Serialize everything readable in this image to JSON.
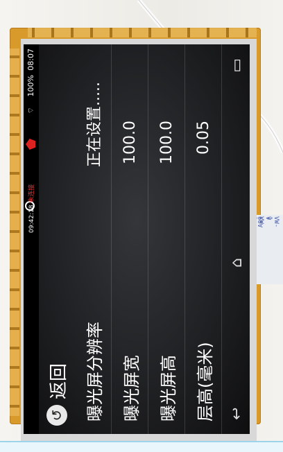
{
  "status_bar": {
    "wifi": "wifi-icon",
    "battery": "100%",
    "time": "08:07",
    "clock_small": "09:42:18",
    "status_text": "未连接"
  },
  "header": {
    "back_label": "返回"
  },
  "settings": [
    {
      "label": "曝光屏分辨率",
      "value": "正在设置....."
    },
    {
      "label": "曝光屏宽",
      "value": "100.0"
    },
    {
      "label": "曝光屏高",
      "value": "100.0"
    },
    {
      "label": "层高(毫米)",
      "value": "0.05"
    }
  ],
  "nav": {
    "back": "↩",
    "home": "⌂",
    "recent": "▭"
  },
  "ribbon_text": [
    "VW-1",
    "V  VW-1",
    "60V  VV"
  ],
  "colors": {
    "flex": "#d99a2c",
    "status_red": "#ee3333"
  }
}
